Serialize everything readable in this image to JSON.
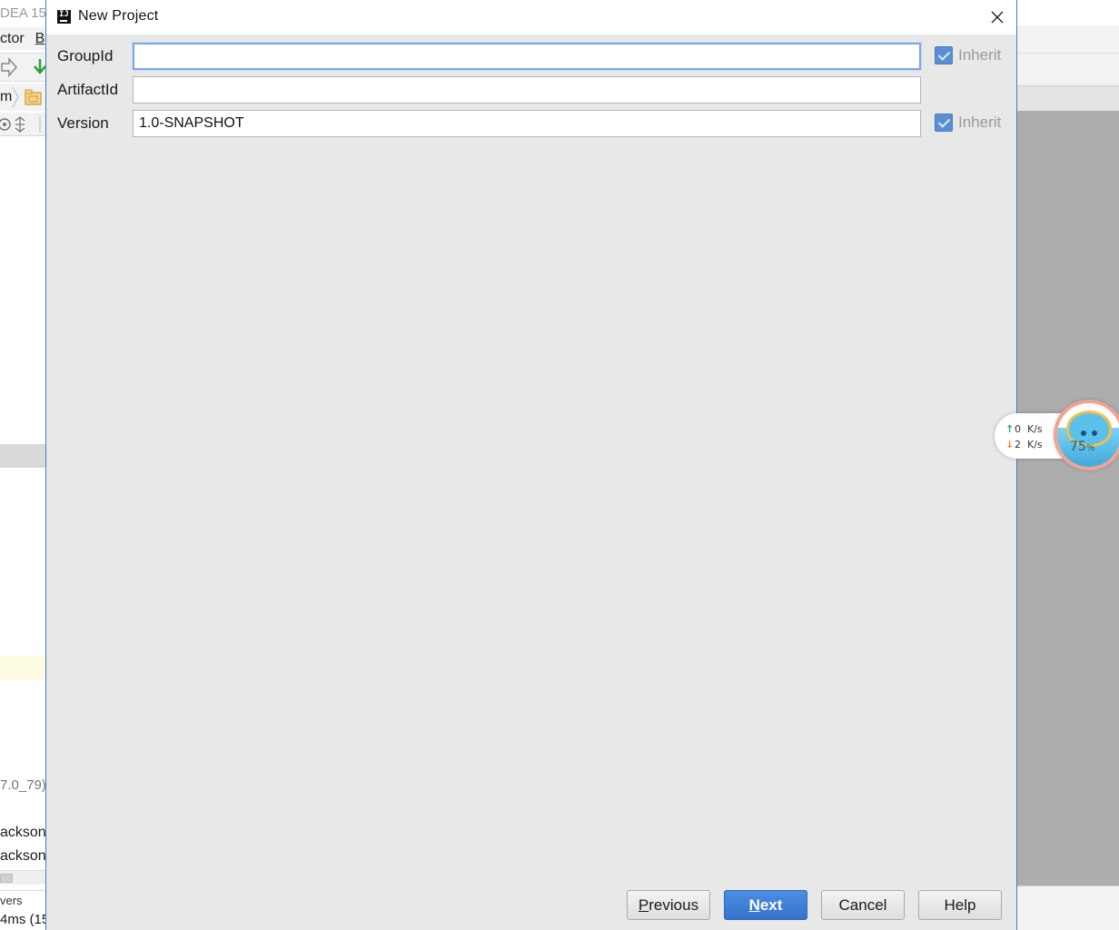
{
  "background_ide": {
    "title_fragment": "DEA 15.",
    "menu_fragment": "ctor",
    "menu_fragment2": "B",
    "breadcrumb_fragment": "m",
    "jdk_fragment": "7.0_79)",
    "line1_fragment": "ackson",
    "line2_fragment": "ackson",
    "status_fragment": "vers",
    "status2_fragment": "4ms (15"
  },
  "dialog": {
    "title": "New Project",
    "fields": {
      "group_id": {
        "label": "GroupId",
        "value": "",
        "inherit_label": "Inherit",
        "inherit_checked": true
      },
      "artifact_id": {
        "label": "ArtifactId",
        "value": ""
      },
      "version": {
        "label": "Version",
        "value": "1.0-SNAPSHOT",
        "inherit_label": "Inherit",
        "inherit_checked": true
      }
    },
    "buttons": {
      "previous": {
        "mnemonic": "P",
        "rest": "revious"
      },
      "next": {
        "mnemonic": "N",
        "rest": "ext"
      },
      "cancel": "Cancel",
      "help": "Help"
    }
  },
  "network_widget": {
    "upload_value": "0",
    "upload_unit": "K/s",
    "download_value": "2",
    "download_unit": "K/s",
    "memory_percent": "75",
    "percent_sign": "%",
    "upload_color": "#2fa84f",
    "download_color": "#f08a2c"
  },
  "colors": {
    "dialog_bg": "#e8e8e8",
    "accent": "#3572cc",
    "focus_border": "#7aa8e0",
    "checkbox": "#5a8fd4"
  }
}
